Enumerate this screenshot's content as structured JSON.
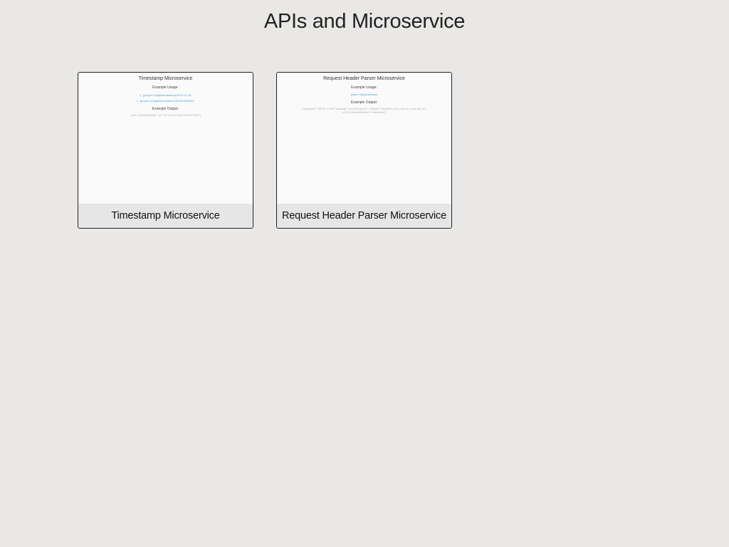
{
  "page": {
    "title": "APIs and Microservice"
  },
  "cards": [
    {
      "caption": "Timestamp Microservice",
      "thumbnail": {
        "title": "Timestamp Microservice",
        "usage_heading": "Example Usage:",
        "usage_links": [
          "[project url]/api/timestamp/2015-12-25",
          "[project url]/api/timestamp/1451001600000"
        ],
        "output_heading": "Example Output:",
        "output_text": "{\"unix\":1451001600000, \"utc\":\"Fri, 25 Dec 2015 00:00:00 GMT\"}"
      }
    },
    {
      "caption": "Request Header Parser Microservice",
      "thumbnail": {
        "title": "Request Header Parser Microservice",
        "usage_heading": "Example Usage:",
        "usage_link": "[base url]/api/whoami",
        "output_heading": "Example Output:",
        "output_text": "{\"ipaddress\":\"159.20.14.100\",\"language\":\"en-US,en;q=0.5\", \"software\":\"Mozilla/5.0 (X11; Ubuntu; Linux x86_64; rv:50.0) Gecko/20100101 Firefox/50.0\"}"
      }
    }
  ]
}
